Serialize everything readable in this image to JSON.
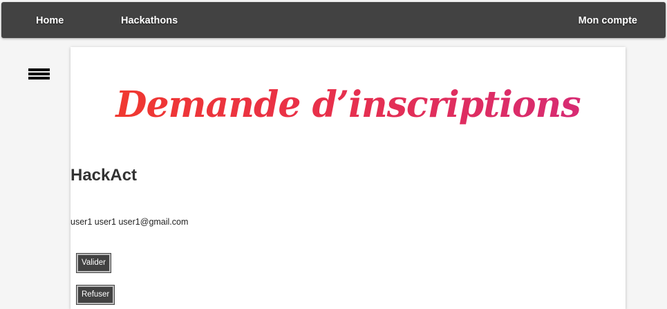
{
  "navbar": {
    "home_label": "Home",
    "hackathons_label": "Hackathons",
    "account_label": "Mon compte"
  },
  "main": {
    "title": "Demande d’inscriptions",
    "title_colors": [
      "#f23a2a",
      "#e8304a",
      "#d42a7a"
    ],
    "hackathon_name": "HackAct",
    "request": {
      "text": "user1 user1 user1@gmail.com",
      "validate_label": "Valider",
      "refuse_label": "Refuser"
    }
  },
  "sidebar": {
    "toggle_icon": "hamburger-menu-icon"
  },
  "colors": {
    "navbar_bg": "#424242",
    "page_bg": "#f5f5f5",
    "button_bg": "#424242"
  }
}
